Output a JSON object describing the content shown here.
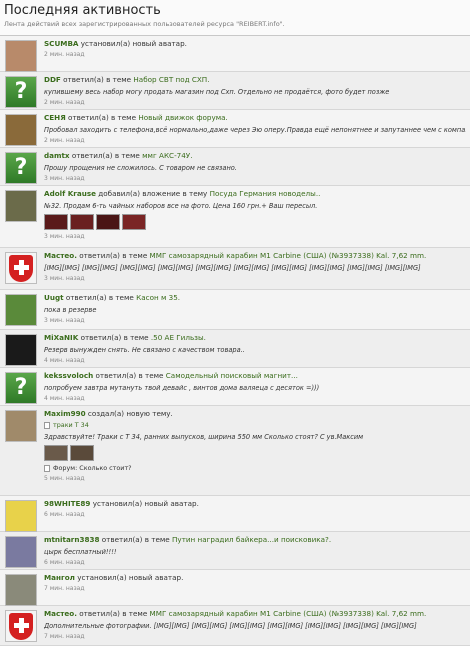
{
  "header": {
    "title": "Последняя активность",
    "subtitle": "Лента действий всех зарегистрированных пользователей ресурса \"REIBERT.info\"."
  },
  "items": [
    {
      "user": "SCUMBA",
      "action": "установил(а) новый аватар.",
      "topic": "",
      "message": "",
      "time": "2 мин. назад",
      "avatar": "avatar-photo-dog",
      "avatar_color": "#b88a6a"
    },
    {
      "user": "DDF",
      "action": "ответил(а) в теме",
      "topic": "Набор СВТ под СХП.",
      "message": "купившему весь набор могу продать магазин под Схп. Отдельно не продаётся, фото будет позже",
      "time": "2 мин. назад",
      "avatar": "question-mark-icon"
    },
    {
      "user": "СЕНЯ",
      "action": "ответил(а) в теме",
      "topic": "Новый движок форума.",
      "message": "Пробовал заходить с телефона,всё нормально,даже через Эю оперу.Правда ещё непонятнее и запутаннее чем с компа!",
      "time": "2 мин. назад",
      "avatar": "avatar-photo-soldier",
      "avatar_color": "#8a6a3a"
    },
    {
      "user": "damtx",
      "action": "ответил(а) в теме",
      "topic": "ммг АКС-74У.",
      "message": "Прошу прощения не сложилось. С товаром не связано.",
      "time": "3 мин. назад",
      "avatar": "question-mark-icon"
    },
    {
      "user": "Adolf Krause",
      "action": "добавил(а) вложение в тему",
      "topic": "Посуда Германия новоделы..",
      "message": "№32. Продам 6-ть чайных наборов все на фото. Цена 160 грн.+ Ваш пересыл.",
      "time": "3 мин. назад",
      "avatar": "avatar-photo-portrait",
      "avatar_color": "#6b6b4a",
      "thumbs": 4
    },
    {
      "user": "Мастео.",
      "action": "ответил(а) в теме",
      "topic": "ММГ самозарядный карабин M1 Carbine (США) (№3937338) Kal. 7,62 mm.",
      "message": "[IMG][IMG] [IMG][IMG] [IMG][IMG] [IMG][IMG] [IMG][IMG] [IMG][IMG] [IMG][IMG] [IMG][IMG] [IMG][IMG] [IMG][IMG]",
      "time": "3 мин. назад",
      "avatar": "swiss-shield-icon"
    },
    {
      "user": "Uugt",
      "action": "ответил(а) в теме",
      "topic": "Касон м 35.",
      "message": "пока в резерве",
      "time": "3 мин. назад",
      "avatar": "avatar-photo-helmet",
      "avatar_color": "#5a8a3a"
    },
    {
      "user": "MiXaNIK",
      "action": "ответил(а) в теме",
      "topic": ".50 AE Гильзы.",
      "message": "Резерв вынужден снять. Не связано с качеством товара..",
      "time": "4 мин. назад",
      "avatar": "avatar-photo-emblem",
      "avatar_color": "#1a1a1a"
    },
    {
      "user": "kekssvoloch",
      "action": "ответил(а) в теме",
      "topic": "Самодельный поисковый магнит...",
      "message": "попробуем завтра мутануть твой девайс , винтов дома валяеца с десяток =)))",
      "time": "4 мин. назад",
      "avatar": "question-mark-icon"
    },
    {
      "user": "Maxim990",
      "action": "создал(а) новую тему.",
      "topic": "",
      "message": "траки Т 34",
      "message2": "Здравствуйте! Траки с Т 34, ранних выпусков, ширина 550 мм Сколько стоят? С ув.Максим",
      "forum": "Форум: Сколько стоит?",
      "time": "5 мин. назад",
      "avatar": "avatar-photo-figure",
      "avatar_color": "#a08a6a",
      "thumbs": 2
    },
    {
      "user": "98WHITE89",
      "action": "установил(а) новый аватар.",
      "topic": "",
      "message": "",
      "time": "6 мин. назад",
      "avatar": "avatar-photo-sign",
      "avatar_color": "#e8d24a"
    },
    {
      "user": "mtnitarn3838",
      "action": "ответил(а) в теме",
      "topic": "Путин наградил байкера...и поисковика?.",
      "message": "цырк бесплатный!!!!",
      "time": "6 мин. назад",
      "avatar": "avatar-photo-person",
      "avatar_color": "#7a7aa0"
    },
    {
      "user": "Мангол",
      "action": "установил(а) новый аватар.",
      "topic": "",
      "message": "",
      "time": "7 мин. назад",
      "avatar": "avatar-photo-tank",
      "avatar_color": "#8a8a7a"
    },
    {
      "user": "Мастео.",
      "action": "ответил(а) в теме",
      "topic": "ММГ самозарядный карабин M1 Carbine (США) (№3937338) Kal. 7,62 mm.",
      "message": "Дополнительные фотографии. [IMG][IMG] [IMG][IMG] [IMG][IMG] [IMG][IMG] [IMG][IMG] [IMG][IMG] [IMG][IMG]",
      "time": "7 мин. назад",
      "avatar": "swiss-shield-icon"
    }
  ]
}
